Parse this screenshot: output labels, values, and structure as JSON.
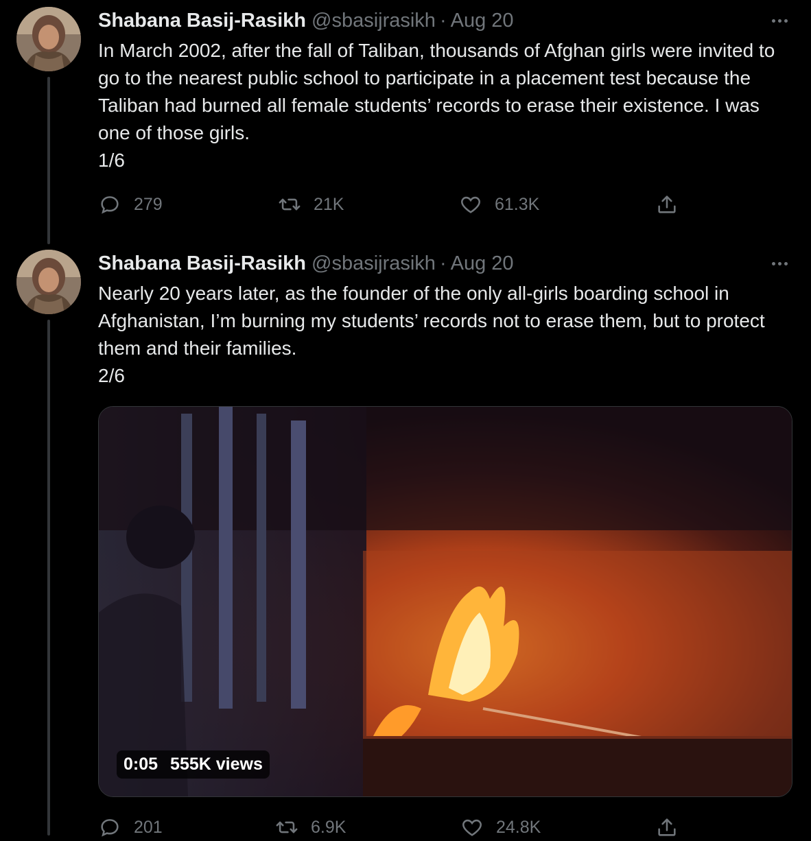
{
  "tweets": [
    {
      "author_name": "Shabana Basij-Rasikh",
      "handle": "@sbasijrasikh",
      "separator": "·",
      "date": "Aug 20",
      "text": "In March 2002, after the fall of Taliban, thousands of Afghan girls were invited to go to the nearest public school to participate in a placement test because the Taliban had burned all female students’ records to erase their existence. I was one of those girls.\n1/6",
      "replies": "279",
      "retweets": "21K",
      "likes": "61.3K"
    },
    {
      "author_name": "Shabana Basij-Rasikh",
      "handle": "@sbasijrasikh",
      "separator": "·",
      "date": "Aug 20",
      "text": "Nearly 20 years later, as the founder of the only all-girls boarding school in Afghanistan, I’m burning my students’ records not to erase them, but to protect them and their families.\n2/6",
      "video_duration": "0:05",
      "video_views": "555K views",
      "replies": "201",
      "retweets": "6.9K",
      "likes": "24.8K"
    }
  ],
  "icons": {
    "reply": "reply-icon",
    "retweet": "retweet-icon",
    "like": "heart-icon",
    "share": "share-icon",
    "more": "more-icon"
  },
  "colors": {
    "background": "#000000",
    "text_primary": "#e7e9ea",
    "text_secondary": "#71767b",
    "thread_line": "#333639"
  }
}
